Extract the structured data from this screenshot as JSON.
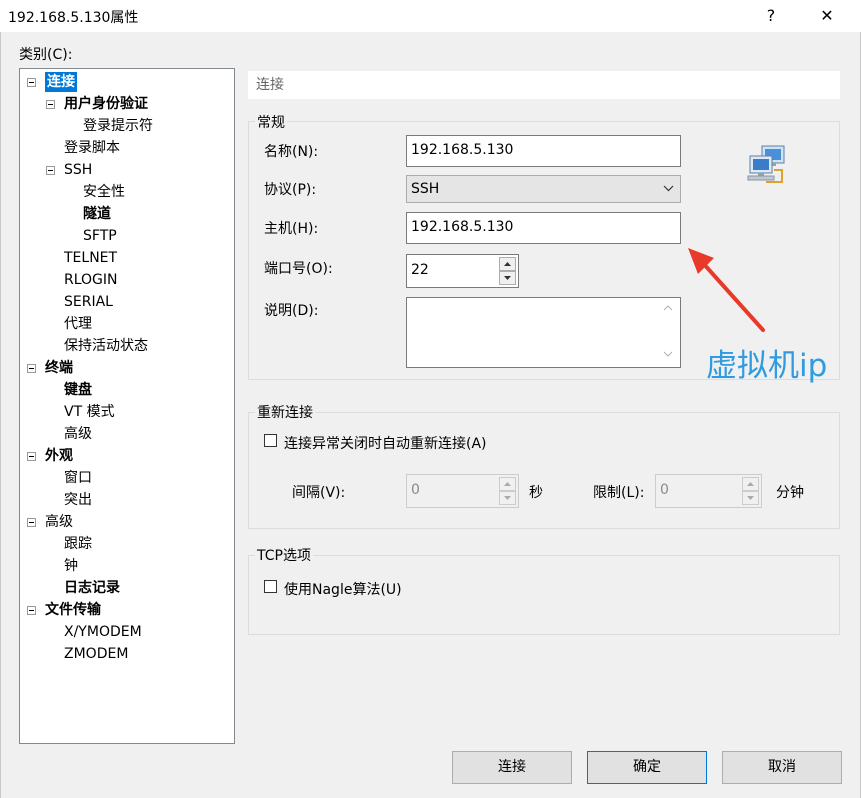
{
  "window": {
    "title": "192.168.5.130属性",
    "help_glyph": "?",
    "close_glyph": "✕"
  },
  "category_label": "类别(C):",
  "category_mnemonic": "C",
  "tree": [
    {
      "label": "连接",
      "bold": true,
      "selected": true,
      "expanded": true
    },
    {
      "label": "用户身份验证",
      "bold": true,
      "expanded": true
    },
    {
      "label": "登录提示符"
    },
    {
      "label": "登录脚本"
    },
    {
      "label": "SSH",
      "expanded": true
    },
    {
      "label": "安全性"
    },
    {
      "label": "隧道",
      "bold": true
    },
    {
      "label": "SFTP"
    },
    {
      "label": "TELNET"
    },
    {
      "label": "RLOGIN"
    },
    {
      "label": "SERIAL"
    },
    {
      "label": "代理"
    },
    {
      "label": "保持活动状态"
    },
    {
      "label": "终端",
      "bold": true,
      "expanded": true
    },
    {
      "label": "键盘",
      "bold": true
    },
    {
      "label": "VT 模式"
    },
    {
      "label": "高级"
    },
    {
      "label": "外观",
      "bold": true,
      "expanded": true
    },
    {
      "label": "窗口"
    },
    {
      "label": "突出"
    },
    {
      "label": "高级",
      "expanded": true
    },
    {
      "label": "跟踪"
    },
    {
      "label": "钟"
    },
    {
      "label": "日志记录",
      "bold": true
    },
    {
      "label": "文件传输",
      "bold": true,
      "expanded": true
    },
    {
      "label": "X/YMODEM"
    },
    {
      "label": "ZMODEM"
    }
  ],
  "panel_header": "连接",
  "general": {
    "title": "常规",
    "name_label": "名称(N):",
    "name_value": "192.168.5.130",
    "protocol_label": "协议(P):",
    "protocol_value": "SSH",
    "host_label": "主机(H):",
    "host_value": "192.168.5.130",
    "port_label": "端口号(O):",
    "port_value": "22",
    "desc_label": "说明(D):",
    "desc_value": ""
  },
  "annotation": "虚拟机ip",
  "reconnect": {
    "title": "重新连接",
    "checkbox_label": "连接异常关闭时自动重新连接(A)",
    "checked": false,
    "interval_label": "间隔(V):",
    "interval_value": "0",
    "interval_unit": "秒",
    "limit_label": "限制(L):",
    "limit_value": "0",
    "limit_unit": "分钟"
  },
  "tcp": {
    "title": "TCP选项",
    "nagle_label": "使用Nagle算法(U)",
    "checked": false
  },
  "buttons": {
    "connect": "连接",
    "ok": "确定",
    "cancel": "取消"
  },
  "colors": {
    "selection": "#0078d7",
    "annotation": "#2f9be0",
    "arrow": "#e8392a"
  },
  "icons": {
    "network": "network-computers-icon",
    "dropdown": "chevron-down-icon",
    "spin_up": "spin-up-icon",
    "spin_down": "spin-down-icon"
  }
}
